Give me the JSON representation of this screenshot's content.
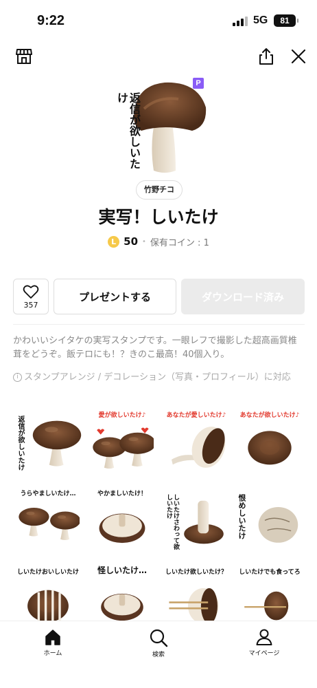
{
  "status": {
    "time": "9:22",
    "network": "5G",
    "battery": "81"
  },
  "topnav": {
    "shop_icon": "shop-icon",
    "share_icon": "share-icon",
    "close_icon": "close-icon"
  },
  "hero": {
    "caption": "返信が欲しいたけ",
    "premium_badge": "P"
  },
  "product": {
    "author": "竹野チコ",
    "title": "実写！しいたけ",
    "coin_symbol": "L",
    "price": "50",
    "owned_coins": "保有コイン : 1"
  },
  "actions": {
    "like_count": "357",
    "gift_label": "プレゼントする",
    "download_label": "ダウンロード済み"
  },
  "description": "かわいいシイタケの実写スタンプです。一眼レフで撮影した超高画質椎茸をどうぞ。飯テロにも！？きのこ最高！40個入り。",
  "arrange_note": "スタンプアレンジ / デコレーション（写真・プロフィール）に対応",
  "stickers": [
    {
      "caption": "返信が欲しいたけ"
    },
    {
      "caption": "愛が欲しいたけ♪"
    },
    {
      "caption": "あなたが愛しいたけ♪"
    },
    {
      "caption": "あなたが欲しいたけ♪"
    },
    {
      "caption": "うらやましいたけ…"
    },
    {
      "caption": "やかましいたけ！"
    },
    {
      "caption": "しいたけさわって欲しいたけ"
    },
    {
      "caption": "恨めしいたけ"
    },
    {
      "caption": "しいたけおいしいたけ"
    },
    {
      "caption": "怪しいたけ…"
    },
    {
      "caption": "しいたけ欲しいたけ？"
    },
    {
      "caption": "しいたけでも食ってろ"
    }
  ],
  "tabbar": {
    "items": [
      {
        "label": "ホーム",
        "icon": "home-icon"
      },
      {
        "label": "検索",
        "icon": "search-icon"
      },
      {
        "label": "マイページ",
        "icon": "person-icon"
      }
    ]
  }
}
